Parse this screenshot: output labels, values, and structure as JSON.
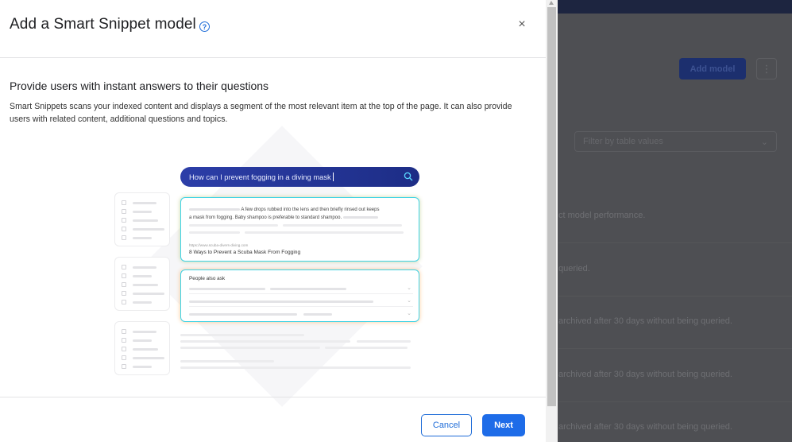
{
  "background": {
    "add_model_label": "Add model",
    "kebab_label": "⋮",
    "filter_placeholder": "Filter by table values",
    "rows": [
      "ct model performance.",
      "queried.",
      "archived after 30 days without being queried.",
      "archived after 30 days without being queried.",
      "archived after 30 days without being queried."
    ]
  },
  "modal": {
    "title": "Add a Smart Snippet model",
    "help_icon": "?",
    "close_icon": "×",
    "heading": "Provide users with instant answers to their questions",
    "description": "Smart Snippets scans your indexed content and displays a segment of the most relevant item at the top of the page. It can also provide users with related content, additional questions and topics.",
    "cancel_label": "Cancel",
    "next_label": "Next"
  },
  "illustration": {
    "search_query": "How can I prevent fogging in a diving mask",
    "answer_text_1": "A few drops rubbed into the lens and then briefly rinsed out keeps",
    "answer_text_2": "a mask from fogging. Baby shampoo is preferable to standard shampoo.",
    "answer_url": "https://www.scuba-divers-diving.com",
    "answer_link": "8 Ways to Prevent a Scuba Mask From Fogging",
    "people_also_ask": "People also ask"
  },
  "colors": {
    "primary": "#1e6ce8",
    "search_bar": "#2c3ea8",
    "card_border": "#3ed3e5"
  }
}
